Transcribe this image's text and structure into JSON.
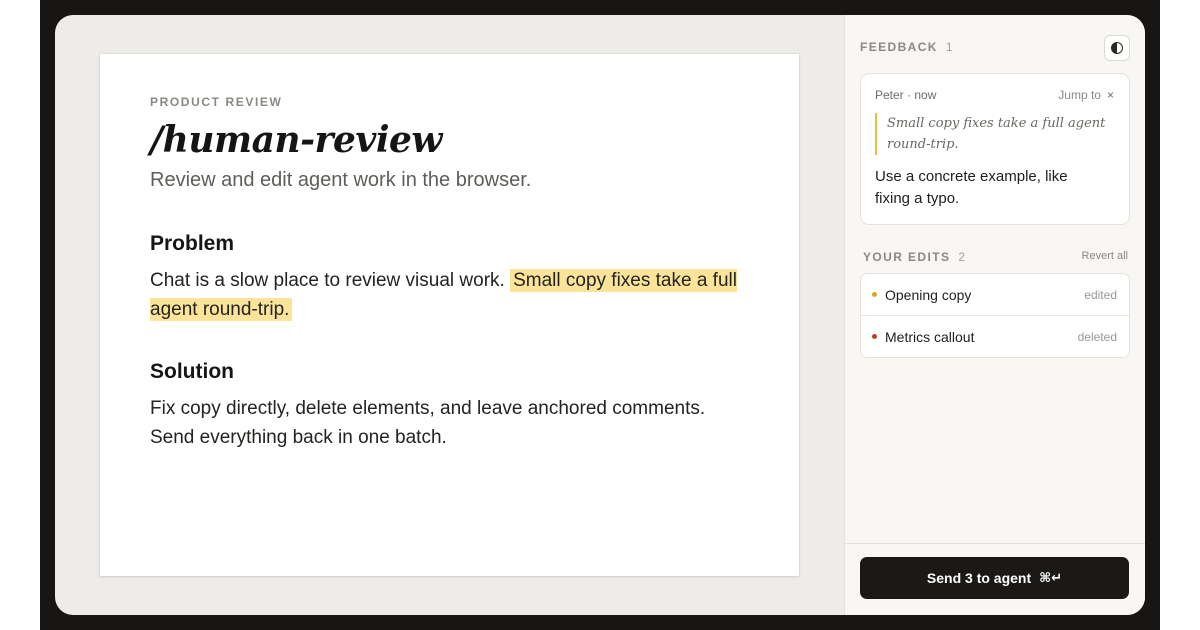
{
  "document": {
    "eyebrow": "PRODUCT REVIEW",
    "title": "/human-review",
    "subtitle": "Review and edit agent work in the browser.",
    "problem_heading": "Problem",
    "problem_text_plain": "Chat is a slow place to review visual work. ",
    "problem_text_highlight": "Small copy fixes take a full agent round-trip.",
    "solution_heading": "Solution",
    "solution_line_1": "Fix copy directly, delete elements, and leave anchored comments.",
    "solution_line_2": "Send everything back in one batch."
  },
  "panel": {
    "feedback_label": "FEEDBACK",
    "feedback_count": "1",
    "theme_icon": "contrast-icon",
    "comment": {
      "meta": "Peter · now",
      "jump_label": "Jump to",
      "close_glyph": "×",
      "quote": "Small copy fixes take a full agent round-trip.",
      "body": "Use a concrete example, like fixing a typo."
    },
    "edits_label": "YOUR EDITS",
    "edits_count": "2",
    "revert_label": "Revert all",
    "edits": [
      {
        "label": "Opening copy",
        "status": "edited",
        "color": "#d9a521"
      },
      {
        "label": "Metrics callout",
        "status": "deleted",
        "color": "#c0392b"
      }
    ],
    "send_label": "Send 3 to agent",
    "send_shortcut": "⌘↵"
  },
  "colors": {
    "highlight": "#fbe49a",
    "quote_bar": "#e8c23b",
    "button": "#1a1917"
  }
}
